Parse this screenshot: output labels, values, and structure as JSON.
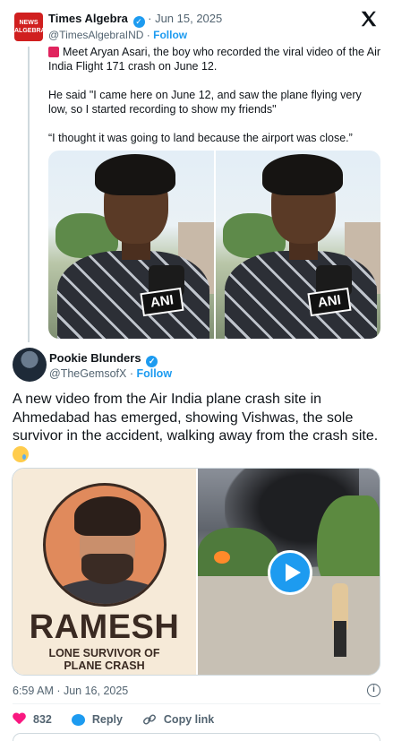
{
  "quoted_tweet": {
    "avatar_text": "NEWS ALGEBRA",
    "name": "Times Algebra",
    "date": "· Jun 15, 2025",
    "handle": "@TimesAlgebraIND",
    "separator": "·",
    "follow": "Follow",
    "paragraph1": "Meet Aryan Asari, the boy who recorded the viral video of the Air India Flight 171 crash on June 12.",
    "paragraph2": "He said \"I came here on June 12, and saw the plane flying very low, so I started recording to show my friends\"",
    "paragraph3": "“I thought it was going to land because the airport was close.”",
    "media_overlay": [
      "ANI",
      "ANI"
    ]
  },
  "tweet": {
    "name": "Pookie Blunders",
    "handle": "@TheGemsofX",
    "separator": "·",
    "follow": "Follow",
    "text": "A new video from the Air India plane crash site in Ahmedabad has emerged, showing Vishwas, the sole survivor in the accident, walking away from the crash site.",
    "poster_title": "RAMESH",
    "poster_sub1": "LONE SURVIVOR OF",
    "poster_sub2": "PLANE CRASH",
    "timestamp": "6:59 AM · Jun 16, 2025",
    "likes": "832",
    "reply_label": "Reply",
    "copy_label": "Copy link"
  },
  "icons": {
    "verified": "verified-badge-icon",
    "x_logo": "x-logo-icon",
    "siren": "police-light-icon",
    "info": "info-icon",
    "heart": "heart-icon",
    "reply": "reply-icon",
    "link": "link-icon",
    "play": "play-icon"
  },
  "colors": {
    "accent": "#1d9bf0",
    "like": "#f91880",
    "muted": "#536471"
  }
}
